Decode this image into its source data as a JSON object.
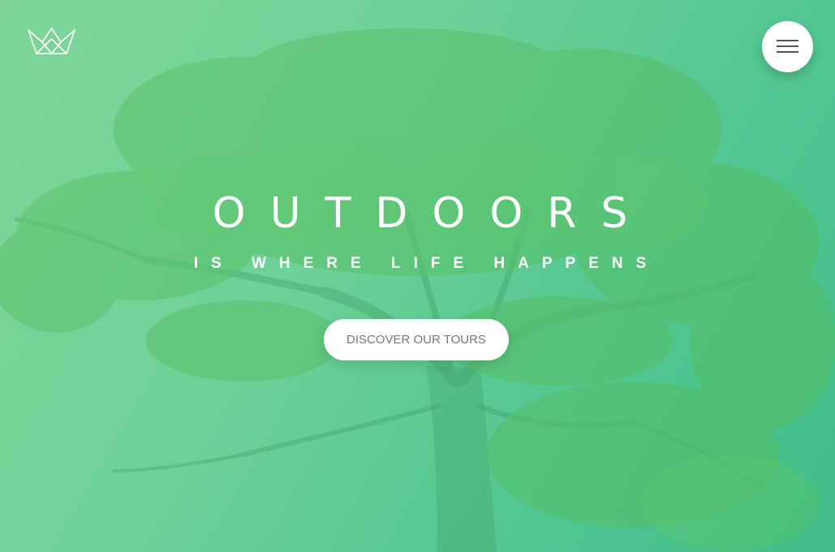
{
  "colors": {
    "background_light": "#7ed59a",
    "background_dark": "#3fbd8a",
    "tree_foliage": "#4fba62",
    "tree_trunk": "#3a9e6a",
    "text": "#ffffff",
    "button_text": "#777777"
  },
  "header": {
    "logo_icon": "crown-icon",
    "menu_icon": "hamburger-icon"
  },
  "hero": {
    "title": "OUTDOORS",
    "subtitle": "IS WHERE LIFE HAPPENS",
    "cta_label": "DISCOVER OUR TOURS",
    "background": "tree-image"
  }
}
